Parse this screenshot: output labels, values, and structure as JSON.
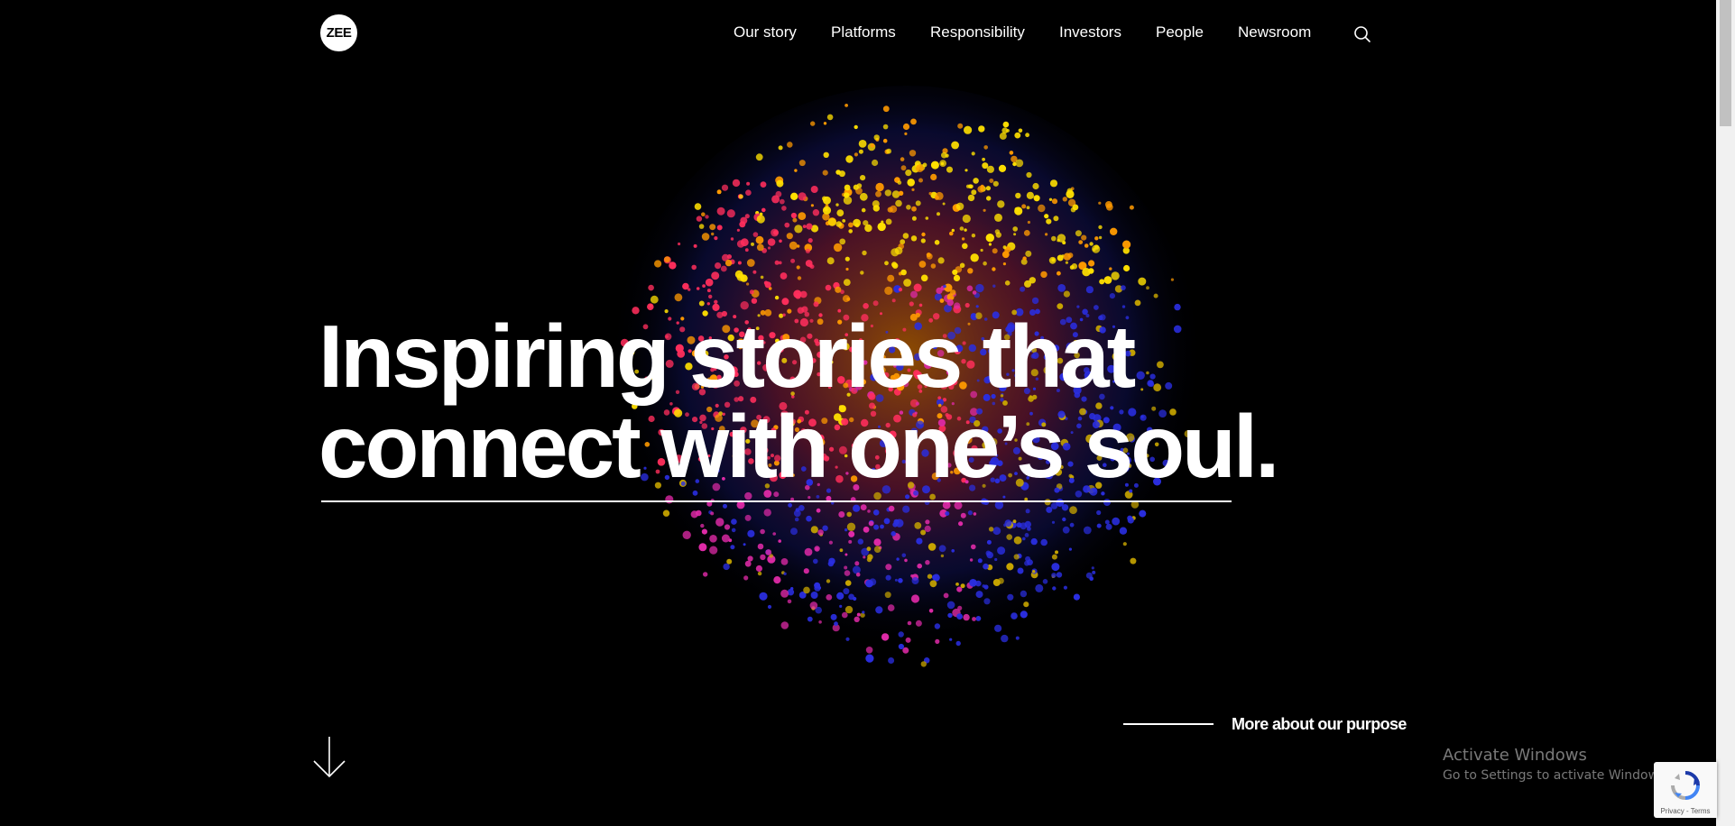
{
  "brand": {
    "logo_text": "ZEE"
  },
  "nav": {
    "items": [
      {
        "label": "Our story"
      },
      {
        "label": "Platforms"
      },
      {
        "label": "Responsibility"
      },
      {
        "label": "Investors"
      },
      {
        "label": "People"
      },
      {
        "label": "Newsroom"
      }
    ],
    "search_icon": "search-icon"
  },
  "hero": {
    "headline_line1": "Inspiring stories that",
    "headline_line2": "connect with one’s soul.",
    "cta_label": "More about our purpose",
    "scroll_icon": "arrow-down-icon",
    "art_colors": [
      "#ffe000",
      "#ff9a00",
      "#ff2e5c",
      "#e02aa8",
      "#2a2ee0",
      "#c9a600"
    ]
  },
  "watermark": {
    "title": "Activate Windows",
    "subtitle": "Go to Settings to activate Windows."
  },
  "recaptcha": {
    "terms": "Privacy - Terms",
    "icon": "recaptcha-icon"
  },
  "colors": {
    "background": "#000000",
    "text": "#ffffff"
  }
}
